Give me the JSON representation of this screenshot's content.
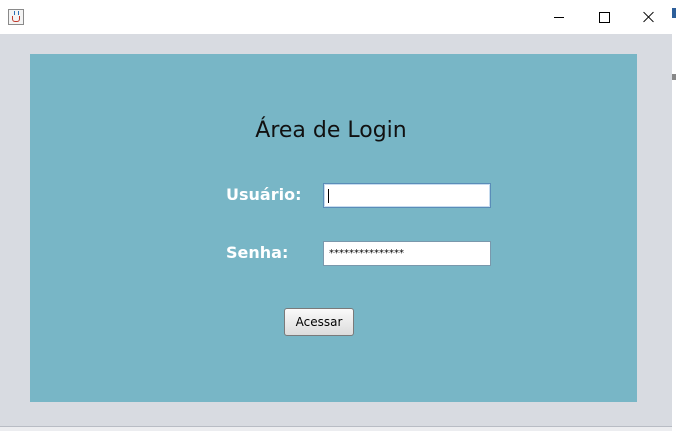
{
  "window": {
    "icon": "java-cup-icon",
    "controls": {
      "minimize": "minimize-icon",
      "maximize": "maximize-icon",
      "close": "close-icon"
    }
  },
  "login": {
    "title": "Área de Login",
    "user_label": "Usuário:",
    "user_value": "",
    "password_label": "Senha:",
    "password_value": "***************",
    "submit_label": "Acessar"
  },
  "colors": {
    "panel_bg": "#78b6c6",
    "window_bg": "#d8dbe1",
    "label_text": "#ffffff"
  }
}
